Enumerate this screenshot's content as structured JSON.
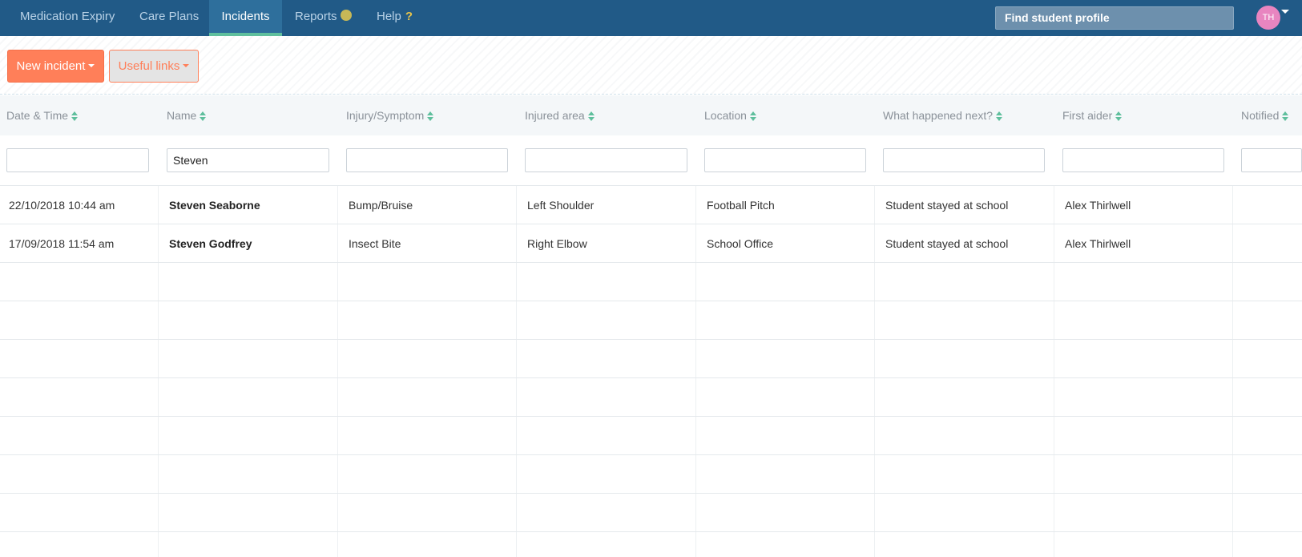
{
  "nav": {
    "items": [
      {
        "label": "Medication Expiry"
      },
      {
        "label": "Care Plans"
      },
      {
        "label": "Incidents"
      },
      {
        "label": "Reports"
      },
      {
        "label": "Help"
      }
    ],
    "active": "Incidents",
    "search_placeholder": "Find student profile",
    "avatar_initials": "TH"
  },
  "toolbar": {
    "new_incident_label": "New incident",
    "useful_links_label": "Useful links"
  },
  "table": {
    "columns": [
      "Date & Time",
      "Name",
      "Injury/Symptom",
      "Injured area",
      "Location",
      "What happened next?",
      "First aider",
      "Notified"
    ],
    "filters": {
      "name": "Steven"
    },
    "rows": [
      {
        "datetime": "22/10/2018 10:44 am",
        "name": "Steven Seaborne",
        "injury": "Bump/Bruise",
        "area": "Left Shoulder",
        "location": "Football Pitch",
        "next": "Student stayed at school",
        "first_aider": "Alex Thirlwell",
        "notified": ""
      },
      {
        "datetime": "17/09/2018 11:54 am",
        "name": "Steven Godfrey",
        "injury": "Insect Bite",
        "area": "Right Elbow",
        "location": "School Office",
        "next": "Student stayed at school",
        "first_aider": "Alex Thirlwell",
        "notified": ""
      }
    ]
  },
  "colors": {
    "nav_bg": "#215a87",
    "accent": "#ff7f59",
    "active_underline": "#5fbf9d"
  }
}
